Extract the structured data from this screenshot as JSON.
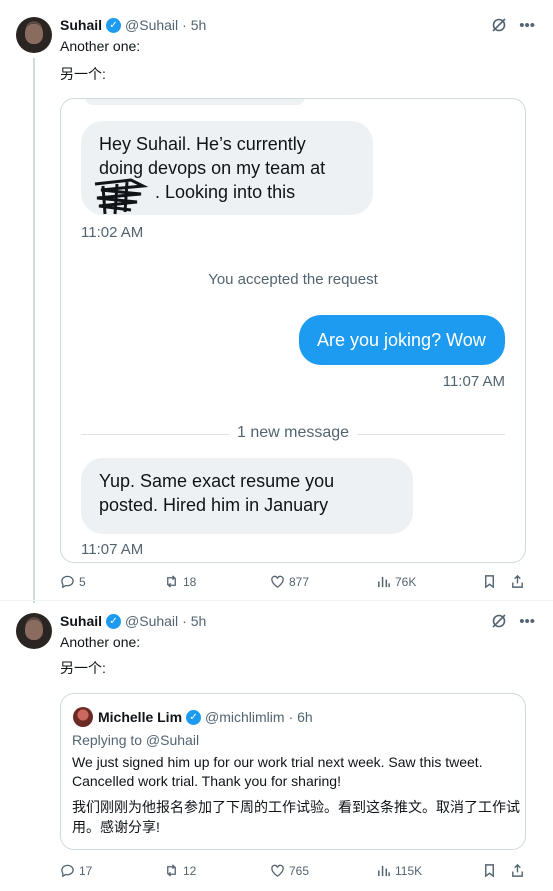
{
  "tweets": [
    {
      "author": {
        "name": "Suhail",
        "handle": "@Suhail",
        "time": "· 5h"
      },
      "text_en": "Another one:",
      "text_zh": "另一个:",
      "dm": {
        "msg1_lines": [
          "Hey Suhail. He’s currently",
          "doing devops on my team at",
          ". Looking into this"
        ],
        "msg1_time": "11:02 AM",
        "system_notice": "You accepted the request",
        "msg2": "Are you joking? Wow",
        "msg2_time": "11:07 AM",
        "new_message_label": "1 new message",
        "msg3_lines": [
          "Yup. Same exact resume you",
          "posted. Hired him in January"
        ],
        "msg3_time": "11:07 AM"
      },
      "stats": {
        "replies": "5",
        "retweets": "18",
        "likes": "877",
        "views": "76K"
      }
    },
    {
      "author": {
        "name": "Suhail",
        "handle": "@Suhail",
        "time": "· 5h"
      },
      "text_en": "Another one:",
      "text_zh": "另一个:",
      "quote": {
        "name": "Michelle Lim",
        "handle": "@michlimlim",
        "time": "· 6h",
        "replying_to": "Replying to @Suhail",
        "text_en_lines": [
          "We just signed him up for our work trial next week. Saw this tweet.",
          "Cancelled work trial. Thank you for sharing!"
        ],
        "text_zh_lines": [
          "我们刚刚为他报名参加了下周的工作试验。看到这条推文。取消了工作试",
          "用。感谢分享!"
        ]
      },
      "stats": {
        "replies": "17",
        "retweets": "12",
        "likes": "765",
        "views": "115K"
      }
    }
  ],
  "colors": {
    "accent": "#1d9bf0",
    "muted": "#536471",
    "bubble_in": "#eef1f3"
  },
  "icons": [
    "verified-badge-icon",
    "grok-icon",
    "more-icon",
    "reply-icon",
    "retweet-icon",
    "like-icon",
    "views-icon",
    "bookmark-icon",
    "share-icon",
    "scribble-redaction"
  ]
}
